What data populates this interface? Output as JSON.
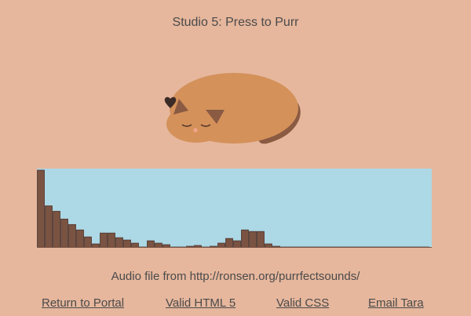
{
  "page": {
    "title": "Studio 5: Press to Purr",
    "credit": "Audio file from http://ronsen.org/purrfectsounds/"
  },
  "colors": {
    "background": "#e6b79d",
    "cat_body": "#d4915a",
    "cat_dark": "#8a5a42",
    "heart": "#3a2b27",
    "visualizer_bg": "#add8e6",
    "bar_fill": "#7a5342"
  },
  "icons": {
    "cat": "sleeping-cat-icon",
    "heart": "heart-icon"
  },
  "visualizer": {
    "levels": [
      1.0,
      0.54,
      0.47,
      0.37,
      0.3,
      0.23,
      0.14,
      0.05,
      0.19,
      0.19,
      0.13,
      0.1,
      0.06,
      0.01,
      0.09,
      0.06,
      0.04,
      0.01,
      0.0,
      0.02,
      0.03,
      0.01,
      0.02,
      0.06,
      0.12,
      0.09,
      0.23,
      0.21,
      0.21,
      0.05,
      0.02,
      0.0,
      0.0,
      0.0,
      0.0,
      0.0,
      0.0,
      0.01,
      0.0,
      0.0,
      0.0,
      0.0,
      0.0,
      0.0,
      0.0,
      0.0,
      0.0,
      0.0,
      0.0,
      0.0
    ]
  },
  "nav": [
    {
      "label": "Return to Portal"
    },
    {
      "label": "Valid HTML 5"
    },
    {
      "label": "Valid CSS"
    },
    {
      "label": "Email Tara"
    }
  ]
}
